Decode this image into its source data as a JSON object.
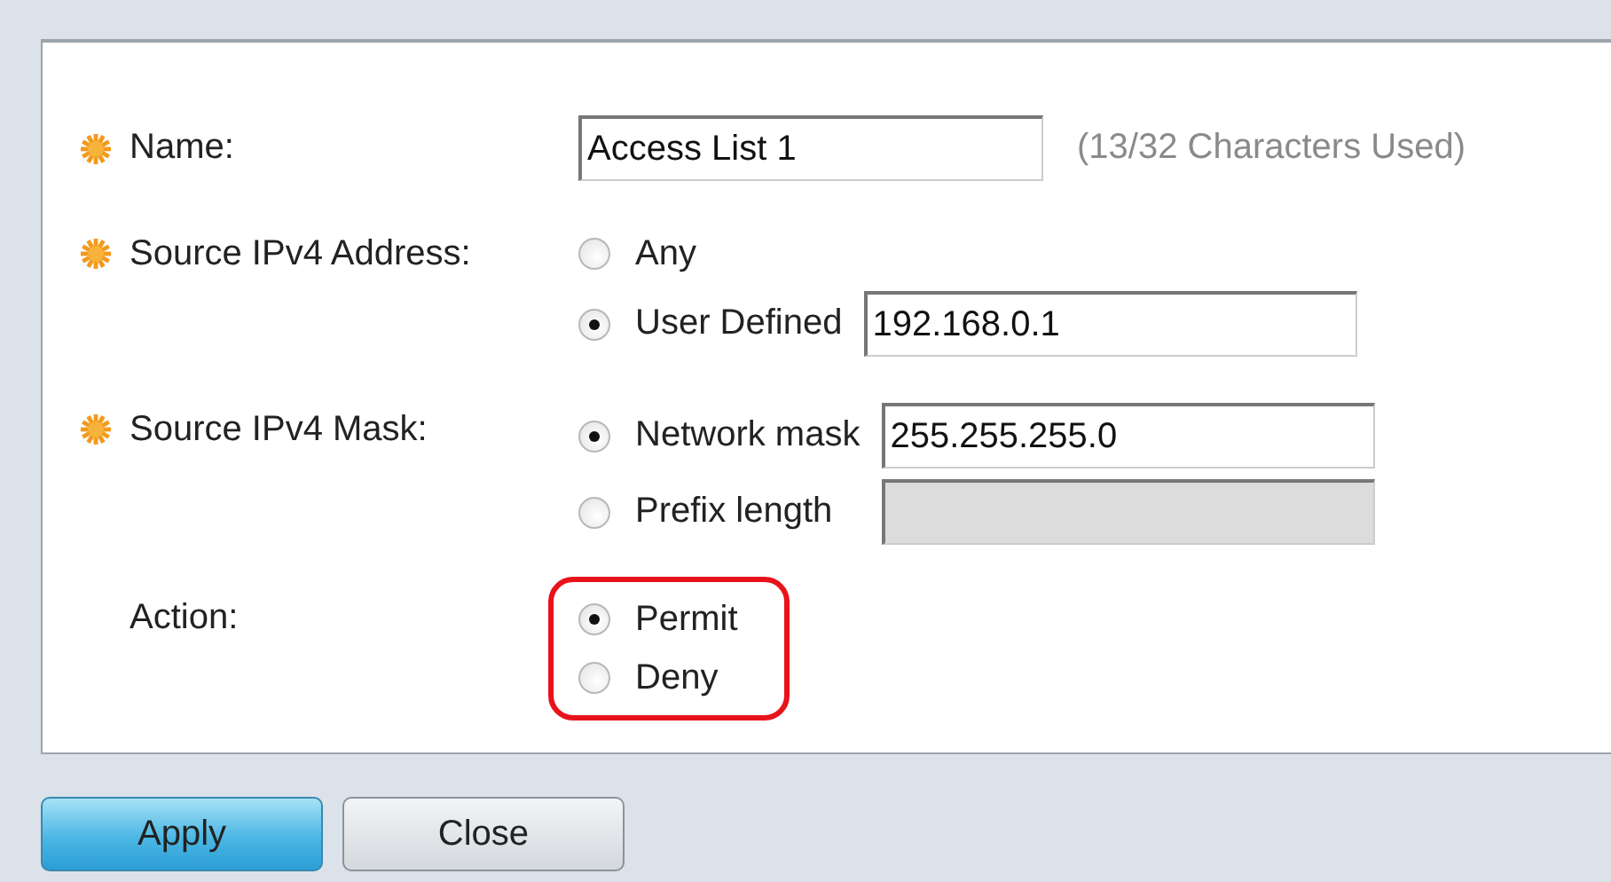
{
  "fields": [
    {
      "label": "Name:",
      "required": true,
      "kind": "text",
      "input": {
        "value": "Access List 1",
        "disabled": false
      },
      "hint": "(13/32 Characters Used)"
    },
    {
      "label": "Source IPv4 Address:",
      "required": true,
      "kind": "radio",
      "options": [
        {
          "label": "Any",
          "selected": false
        },
        {
          "label": "User Defined",
          "selected": true,
          "input": {
            "value": "192.168.0.1",
            "disabled": false
          }
        }
      ]
    },
    {
      "label": "Source IPv4 Mask:",
      "required": true,
      "kind": "radio",
      "options": [
        {
          "label": "Network mask",
          "selected": true,
          "input": {
            "value": "255.255.255.0",
            "disabled": false
          }
        },
        {
          "label": "Prefix length",
          "selected": false,
          "input": {
            "disabled": true
          }
        }
      ]
    },
    {
      "label": "Action:",
      "required": false,
      "kind": "radio",
      "highlighted": true,
      "options": [
        {
          "label": "Permit",
          "selected": true
        },
        {
          "label": "Deny",
          "selected": false
        }
      ]
    }
  ],
  "buttons": [
    {
      "label": "Apply",
      "primary": true
    },
    {
      "label": "Close",
      "primary": false
    }
  ]
}
